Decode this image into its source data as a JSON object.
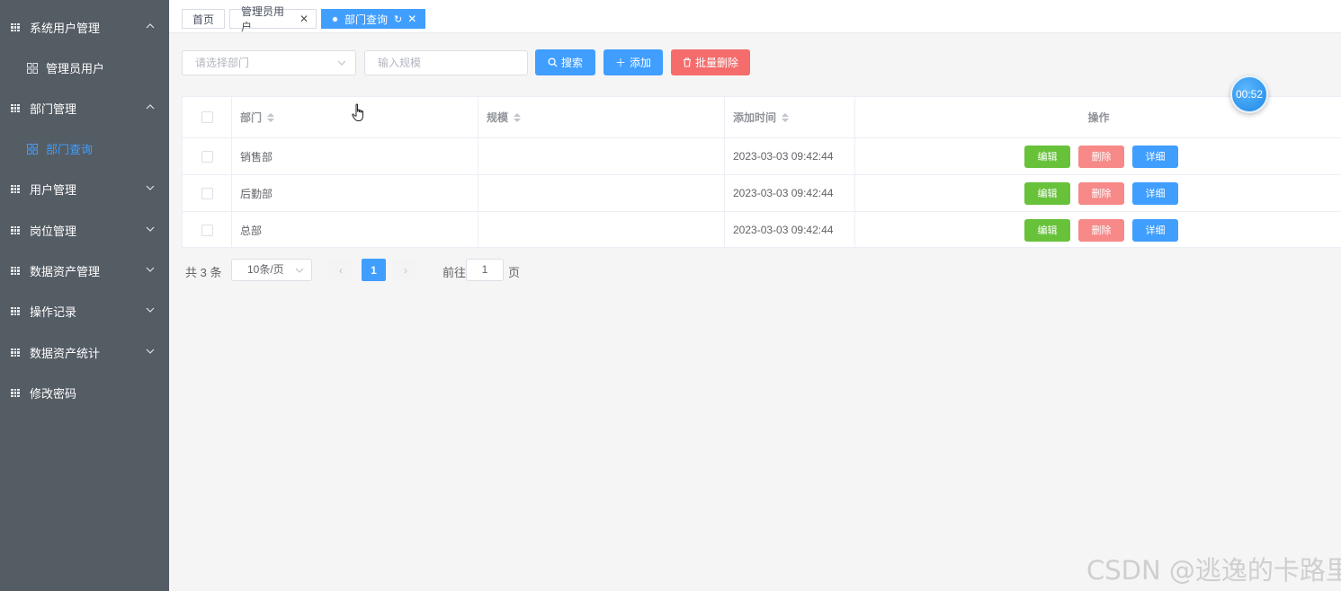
{
  "sidebar": {
    "items": [
      {
        "label": "系统用户管理",
        "expanded": true
      },
      {
        "label": "管理员用户",
        "sub": true
      },
      {
        "label": "部门管理",
        "expanded": true
      },
      {
        "label": "部门查询",
        "sub": true,
        "active": true
      },
      {
        "label": "用户管理",
        "expanded": false
      },
      {
        "label": "岗位管理",
        "expanded": false
      },
      {
        "label": "数据资产管理",
        "expanded": false
      },
      {
        "label": "操作记录",
        "expanded": false
      },
      {
        "label": "数据资产统计",
        "expanded": false
      },
      {
        "label": "修改密码"
      }
    ]
  },
  "tabs": [
    {
      "label": "首页"
    },
    {
      "label": "管理员用户"
    },
    {
      "label": "部门查询",
      "active": true
    }
  ],
  "filters": {
    "department_placeholder": "请选择部门",
    "scale_placeholder": "输入规模",
    "search_label": "搜索",
    "add_label": "添加",
    "batch_delete_label": "批量删除"
  },
  "table": {
    "headers": {
      "dept": "部门",
      "scale": "规模",
      "time": "添加时间",
      "ops": "操作"
    },
    "rows": [
      {
        "dept": "销售部",
        "scale": "",
        "time": "2023-03-03 09:42:44"
      },
      {
        "dept": "后勤部",
        "scale": "",
        "time": "2023-03-03 09:42:44"
      },
      {
        "dept": "总部",
        "scale": "",
        "time": "2023-03-03 09:42:44"
      }
    ],
    "actions": {
      "edit": "编辑",
      "delete": "删除",
      "detail": "详细"
    }
  },
  "pagination": {
    "total": "共 3 条",
    "page_size": "10条/页",
    "current": "1",
    "goto_label": "前往",
    "goto_value": "1",
    "page_suffix": "页"
  },
  "timer": "00:52",
  "watermark": "CSDN @逃逸的卡路里",
  "colors": {
    "sidebar_bg": "#545c64",
    "primary": "#409eff",
    "danger": "#f56c6c",
    "success": "#67c23a"
  }
}
